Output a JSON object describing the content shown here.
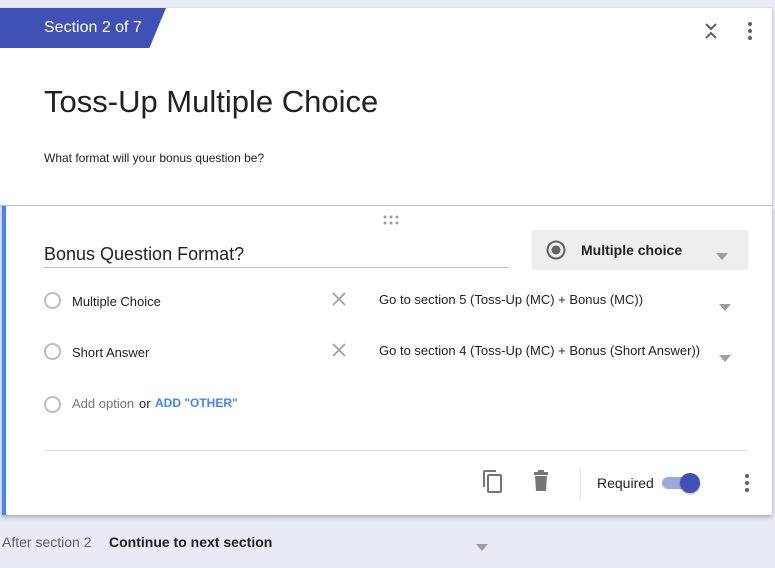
{
  "section": {
    "badge": "Section 2 of 7",
    "title": "Toss-Up Multiple Choice",
    "description": "What format will your bonus question be?"
  },
  "question": {
    "title": "Bonus Question Format?",
    "type_label": "Multiple choice",
    "options": [
      {
        "label": "Multiple Choice",
        "goto": "Go to section 5 (Toss-Up (MC) + Bonus (MC))"
      },
      {
        "label": "Short Answer",
        "goto": "Go to section 4 (Toss-Up (MC) + Bonus (Short Answer))"
      }
    ],
    "add_option": "Add option",
    "or_text": "or",
    "add_other": "ADD \"OTHER\"",
    "required_label": "Required",
    "required": true
  },
  "after_section": {
    "label": "After section 2",
    "value": "Continue to next section"
  },
  "colors": {
    "accent": "#3f51b5",
    "link": "#4285f4",
    "background": "#e8eaf6"
  },
  "icons": [
    "collapse-icon",
    "more-vert-icon",
    "drag-handle-icon",
    "radio-icon",
    "close-icon",
    "dropdown-arrow-icon",
    "duplicate-icon",
    "delete-icon"
  ]
}
